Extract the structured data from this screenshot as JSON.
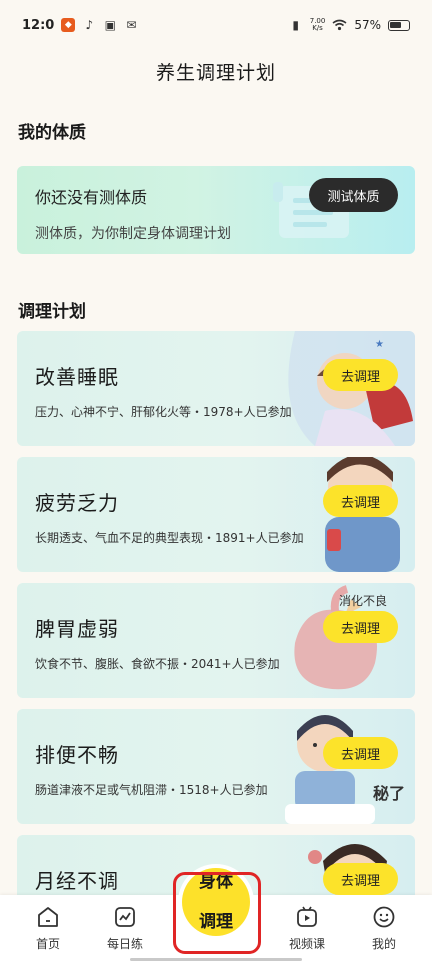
{
  "status_bar": {
    "time": "12:0",
    "net_speed_top": "7.00",
    "net_speed_bottom": "K/s",
    "battery": "57%"
  },
  "header": {
    "title": "养生调理计划"
  },
  "constitution": {
    "section_title": "我的体质",
    "title": "你还没有测体质",
    "subtitle": "测体质，为你制定身体调理计划",
    "button": "测试体质"
  },
  "plans": {
    "section_title": "调理计划",
    "items": [
      {
        "name": "改善睡眠",
        "desc": "压力、心神不宁、肝郁化火等・1978+人已参加",
        "button": "去调理",
        "art_icon": "sleeping-person-illustration"
      },
      {
        "name": "疲劳乏力",
        "desc": "长期透支、气血不足的典型表现・1891+人已参加",
        "button": "去调理",
        "art_icon": "tired-person-illustration"
      },
      {
        "name": "脾胃虚弱",
        "desc": "饮食不节、腹胀、食欲不振・2041+人已参加",
        "button": "去调理",
        "art_icon": "stomach-illustration",
        "art_text": "消化不良"
      },
      {
        "name": "排便不畅",
        "desc": "肠道津液不足或气机阻滞・1518+人已参加",
        "button": "去调理",
        "art_icon": "toilet-person-illustration",
        "art_text": "秘了"
      },
      {
        "name": "月经不调",
        "desc": "",
        "button": "去调理",
        "art_icon": "woman-illustration"
      }
    ]
  },
  "tab_bar": {
    "home": "首页",
    "daily": "每日练",
    "center_line1": "身体",
    "center_line2": "调理",
    "video": "视频课",
    "mine": "我的"
  }
}
